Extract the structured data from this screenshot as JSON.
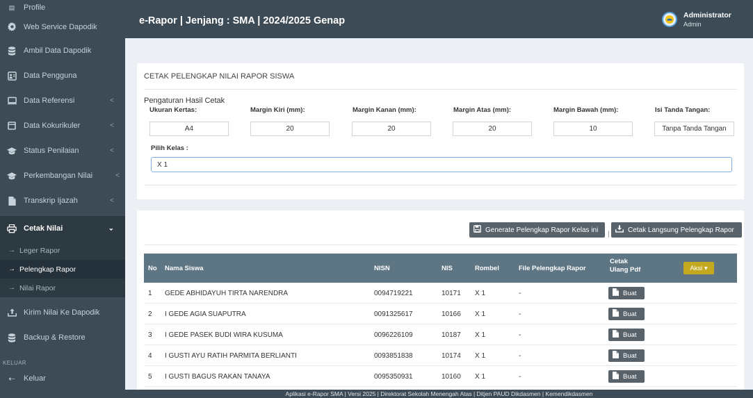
{
  "topbar": {
    "title": "e-Rapor | Jenjang : SMA | 2024/2025 Genap",
    "user_name": "Administrator",
    "user_role": "Admin"
  },
  "sidebar": {
    "items": [
      {
        "label": "Profile",
        "icon": "profile-icon",
        "chevron": ""
      },
      {
        "label": "Web Service Dapodik",
        "icon": "gear-icon",
        "chevron": ""
      },
      {
        "label": "Ambil Data Dapodik",
        "icon": "database-icon",
        "chevron": ""
      },
      {
        "label": "Data Pengguna",
        "icon": "users-icon",
        "chevron": ""
      },
      {
        "label": "Data Referensi",
        "icon": "monitor-icon",
        "chevron": "<"
      },
      {
        "label": "Data Kokurikuler",
        "icon": "window-icon",
        "chevron": "<"
      },
      {
        "label": "Status Penilaian",
        "icon": "graduation-cap-icon",
        "chevron": "<"
      },
      {
        "label": "Perkembangan Nilai",
        "icon": "graduation-cap-icon",
        "chevron": "<"
      },
      {
        "label": "Transkrip Ijazah",
        "icon": "document-icon",
        "chevron": "<"
      },
      {
        "label": "Cetak Nilai",
        "icon": "printer-icon",
        "chevron": "⌄"
      }
    ],
    "sub_items": [
      {
        "label": "Leger Rapor"
      },
      {
        "label": "Pelengkap Rapor"
      },
      {
        "label": "Nilai Rapor"
      }
    ],
    "items_after": [
      {
        "label": "Kirim Nilai Ke Dapodik",
        "icon": "upload-icon"
      },
      {
        "label": "Backup & Restore",
        "icon": "database-icon"
      }
    ],
    "section_header": "KELUAR",
    "logout_label": "Keluar"
  },
  "panel1": {
    "title": "CETAK PELENGKAP NILAI RAPOR SISWA",
    "section_title": "Pengaturan Hasil Cetak",
    "fields": [
      {
        "label": "Ukuran Kertas:",
        "value": "A4"
      },
      {
        "label": "Margin Kiri (mm):",
        "value": "20"
      },
      {
        "label": "Margin Kanan (mm):",
        "value": "20"
      },
      {
        "label": "Margin Atas (mm):",
        "value": "20"
      },
      {
        "label": "Margin Bawah (mm):",
        "value": "10"
      },
      {
        "label": "Isi Tanda Tangan:",
        "value": "Tanpa Tanda Tangan"
      }
    ],
    "kelas_label": "Pilih Kelas :",
    "kelas_value": "X 1"
  },
  "panel2": {
    "generate_button": "Generate Pelengkap Rapor Kelas ini",
    "separator": "|",
    "cetak_button": "Cetak Langsung Pelengkap Rapor",
    "table": {
      "headers": {
        "no": "No",
        "nama": "Nama Siswa",
        "nisn": "NISN",
        "nis": "NIS",
        "rombel": "Rombel",
        "file": "File Pelengkap Rapor",
        "cetak_1": "Cetak",
        "cetak_2": "Ulang Pdf",
        "aksi": "Aksi ▾"
      },
      "rows": [
        {
          "no": "1",
          "nama": "GEDE ABHIDAYUH TIRTA NARENDRA",
          "nisn": "0094719221",
          "nis": "10171",
          "rombel": "X 1",
          "file": "-",
          "action": "Buat"
        },
        {
          "no": "2",
          "nama": "I GEDE AGIA SUAPUTRA",
          "nisn": "0091325617",
          "nis": "10166",
          "rombel": "X 1",
          "file": "-",
          "action": "Buat"
        },
        {
          "no": "3",
          "nama": "I GEDE PASEK BUDI WIRA KUSUMA",
          "nisn": "0096226109",
          "nis": "10187",
          "rombel": "X 1",
          "file": "-",
          "action": "Buat"
        },
        {
          "no": "4",
          "nama": "I GUSTI AYU RATIH PARMITA BERLIANTI",
          "nisn": "0093851838",
          "nis": "10174",
          "rombel": "X 1",
          "file": "-",
          "action": "Buat"
        },
        {
          "no": "5",
          "nama": "I GUSTI BAGUS RAKAN TANAYA",
          "nisn": "0095350931",
          "nis": "10160",
          "rombel": "X 1",
          "file": "-",
          "action": "Buat"
        }
      ]
    }
  },
  "footer": {
    "text": "Aplikasi e-Rapor SMA | Versi 2025 | Direktorat Sekolah Menengah Atas | Ditjen PAUD Dikdasmen | Kemendikdasmen"
  },
  "colors": {
    "sidebar": "#3c4b55",
    "table_header": "#5e7583",
    "aksi_button": "#c4a920",
    "button": "#57626b"
  }
}
